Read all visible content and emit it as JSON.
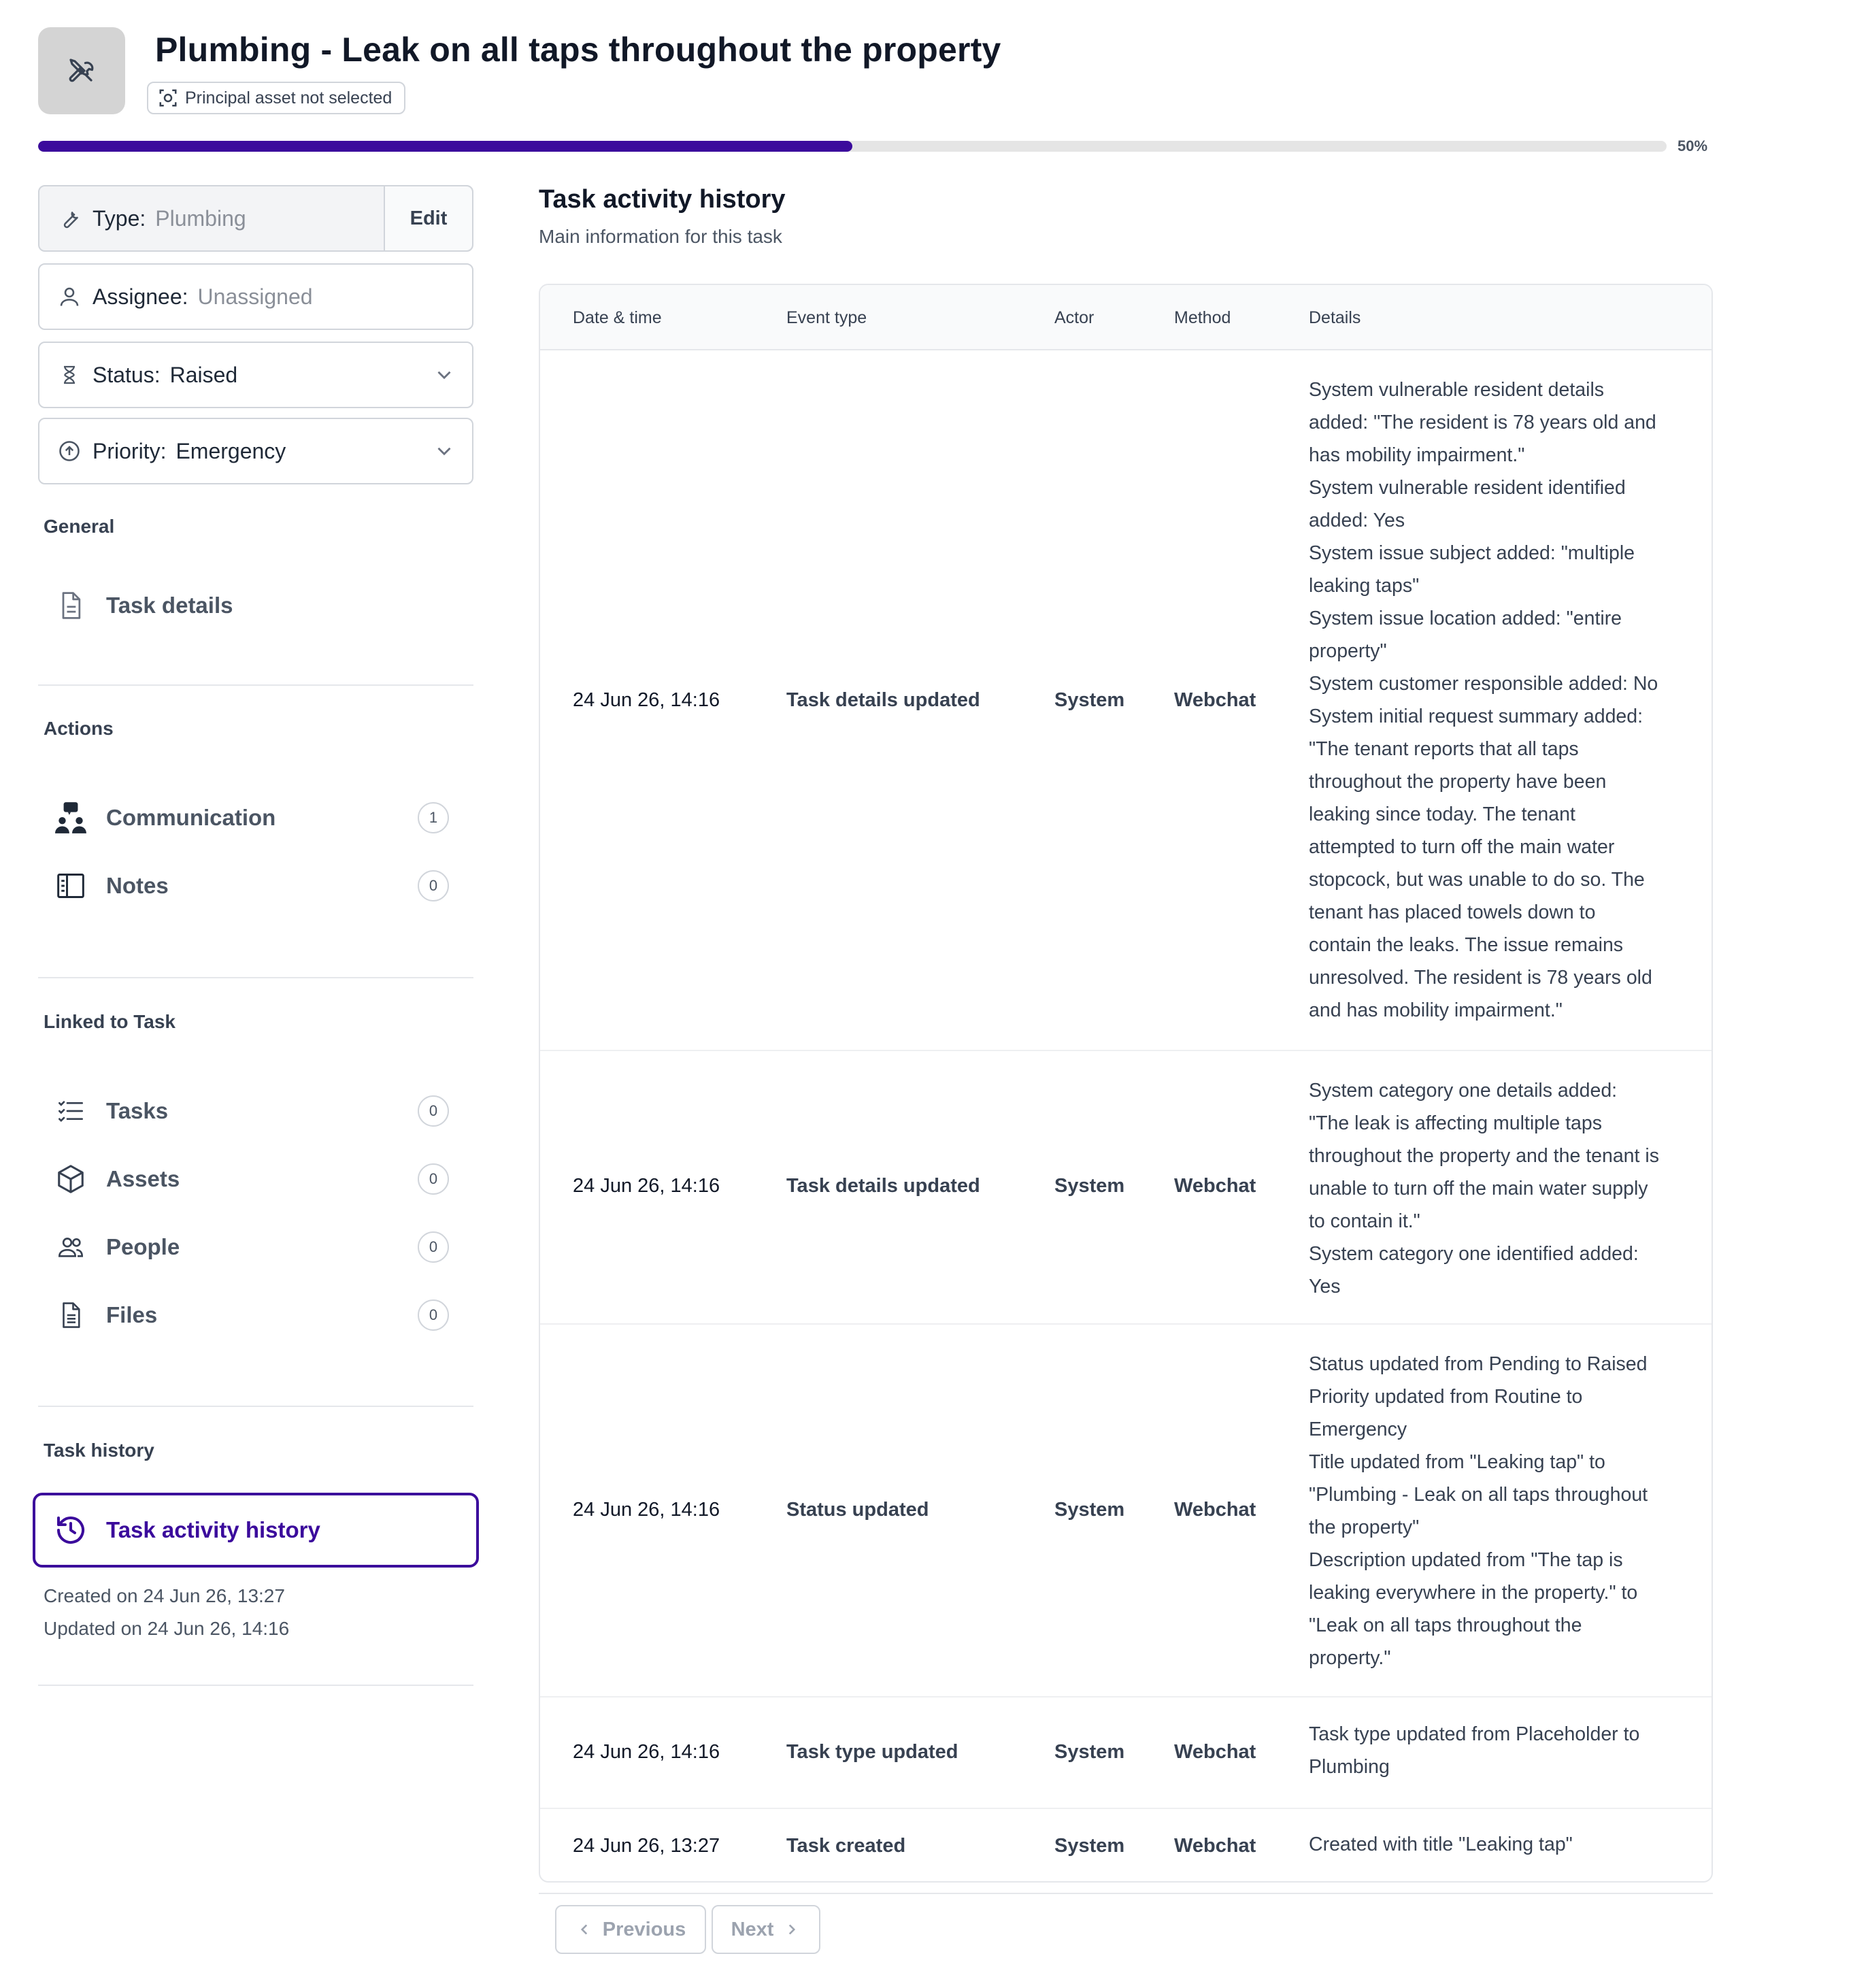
{
  "header": {
    "title": "Plumbing - Leak on all taps throughout the property",
    "asset_pill": "Principal asset not selected",
    "progress_percent": 50,
    "progress_label": "50%",
    "header_icon": "tools-icon",
    "accent_color": "#3b0b9c"
  },
  "fields": {
    "type": {
      "label": "Type:",
      "value": "Plumbing",
      "edit_label": "Edit"
    },
    "assignee": {
      "label": "Assignee:",
      "value": "Unassigned"
    },
    "status": {
      "label": "Status:",
      "value": "Raised"
    },
    "priority": {
      "label": "Priority:",
      "value": "Emergency"
    }
  },
  "sidebar": {
    "general": {
      "title": "General",
      "items": [
        {
          "label": "Task details",
          "icon": "document-icon"
        }
      ]
    },
    "actions": {
      "title": "Actions",
      "items": [
        {
          "label": "Communication",
          "count": "1",
          "icon": "communication-icon"
        },
        {
          "label": "Notes",
          "count": "0",
          "icon": "notes-icon"
        }
      ]
    },
    "linked": {
      "title": "Linked to Task",
      "items": [
        {
          "label": "Tasks",
          "count": "0",
          "icon": "checklist-icon"
        },
        {
          "label": "Assets",
          "count": "0",
          "icon": "cube-icon"
        },
        {
          "label": "People",
          "count": "0",
          "icon": "people-icon"
        },
        {
          "label": "Files",
          "count": "0",
          "icon": "file-icon"
        }
      ]
    },
    "history": {
      "title": "Task history",
      "active_item": {
        "label": "Task activity history",
        "icon": "history-icon"
      },
      "created": "Created on 24 Jun 26, 13:27",
      "updated": "Updated on 24 Jun 26, 14:16"
    }
  },
  "main": {
    "title": "Task activity history",
    "subtitle": "Main information for this task",
    "columns": [
      "Date & time",
      "Event type",
      "Actor",
      "Method",
      "Details"
    ],
    "rows": [
      {
        "date": "24 Jun 26, 14:16",
        "event": "Task details updated",
        "actor": "System",
        "method": "Webchat",
        "details": [
          "System vulnerable resident details",
          "added: \"The resident is 78 years old and",
          "has mobility impairment.\"",
          "System vulnerable resident identified",
          "added: Yes",
          "System issue subject added: \"multiple",
          "leaking taps\"",
          "System issue location added: \"entire",
          "property\"",
          "System customer responsible added: No",
          "System initial request summary added:",
          "\"The tenant reports that all taps",
          "throughout the property have been",
          "leaking since today. The tenant",
          "attempted to turn off the main water",
          "stopcock, but was unable to do so. The",
          "tenant has placed towels down to",
          "contain the leaks. The issue remains",
          "unresolved. The resident is 78 years old",
          "and has mobility impairment.\""
        ]
      },
      {
        "date": "24 Jun 26, 14:16",
        "event": "Task details updated",
        "actor": "System",
        "method": "Webchat",
        "details": [
          "System category one details added:",
          "\"The leak is affecting multiple taps",
          "throughout the property and the tenant is",
          "unable to turn off the main water supply",
          "to contain it.\"",
          "System category one identified added:",
          "Yes"
        ]
      },
      {
        "date": "24 Jun 26, 14:16",
        "event": "Status updated",
        "actor": "System",
        "method": "Webchat",
        "details": [
          "Status updated from Pending to Raised",
          "Priority updated from Routine to",
          "Emergency",
          "Title updated from \"Leaking tap\" to",
          "\"Plumbing - Leak on all taps throughout",
          "the property\"",
          "Description updated from \"The tap is",
          "leaking everywhere in the property.\" to",
          "\"Leak on all taps throughout the",
          "property.\""
        ]
      },
      {
        "date": "24 Jun 26, 14:16",
        "event": "Task type updated",
        "actor": "System",
        "method": "Webchat",
        "details": [
          "Task type updated from Placeholder to",
          "Plumbing"
        ]
      },
      {
        "date": "24 Jun 26, 13:27",
        "event": "Task created",
        "actor": "System",
        "method": "Webchat",
        "details": [
          "Created with title \"Leaking tap\""
        ]
      }
    ]
  },
  "pagination": {
    "previous": "Previous",
    "next": "Next"
  }
}
